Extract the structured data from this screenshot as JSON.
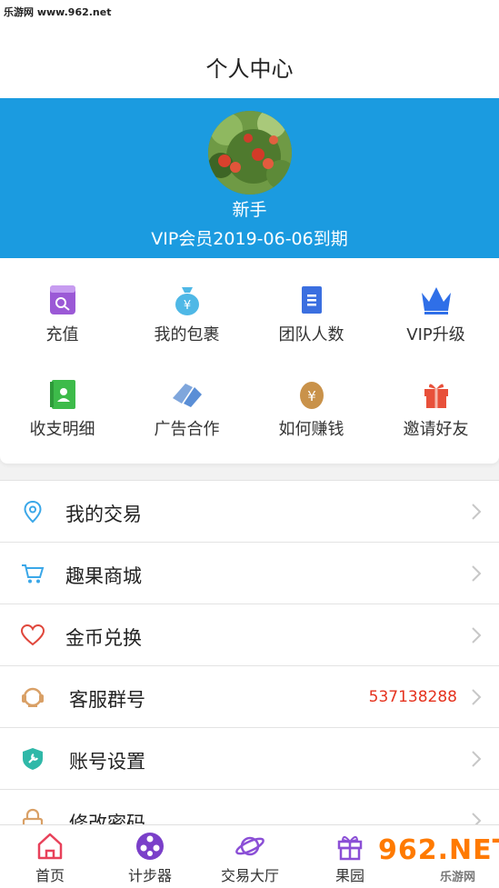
{
  "status_bar": {
    "watermark": "乐游网 www.962.net"
  },
  "header": {
    "title": "个人中心"
  },
  "profile": {
    "name": "新手",
    "vip_text": "VIP会员2019-06-06到期"
  },
  "grid": {
    "items": [
      {
        "label": "充值",
        "icon": "recharge-card-icon",
        "color": "#9b59d6"
      },
      {
        "label": "我的包裹",
        "icon": "money-bag-icon",
        "color": "#4fb8e6"
      },
      {
        "label": "团队人数",
        "icon": "document-icon",
        "color": "#3b6fe0"
      },
      {
        "label": "VIP升级",
        "icon": "crown-icon",
        "color": "#2f6fe8"
      },
      {
        "label": "收支明细",
        "icon": "contact-book-icon",
        "color": "#3dbb4a"
      },
      {
        "label": "广告合作",
        "icon": "handshake-icon",
        "color": "#5a8ed6"
      },
      {
        "label": "如何赚钱",
        "icon": "yen-coin-icon",
        "color": "#c9924a"
      },
      {
        "label": "邀请好友",
        "icon": "gift-icon",
        "color": "#e8503a"
      }
    ]
  },
  "menu": {
    "items": [
      {
        "label": "我的交易",
        "icon": "location-pin-icon",
        "value": ""
      },
      {
        "label": "趣果商城",
        "icon": "shopping-cart-icon",
        "value": ""
      },
      {
        "label": "金币兑换",
        "icon": "heart-icon",
        "value": ""
      },
      {
        "label": "客服群号",
        "icon": "headset-icon",
        "value": "537138288"
      },
      {
        "label": "账号设置",
        "icon": "wrench-shield-icon",
        "value": ""
      },
      {
        "label": "修改密码",
        "icon": "lock-icon",
        "value": ""
      }
    ]
  },
  "tabs": {
    "items": [
      {
        "label": "首页",
        "icon": "home-icon"
      },
      {
        "label": "计步器",
        "icon": "film-reel-icon"
      },
      {
        "label": "交易大厅",
        "icon": "planet-icon"
      },
      {
        "label": "果园",
        "icon": "gift-box-icon"
      }
    ]
  },
  "watermark": {
    "main": "962.NET",
    "sub": "乐游网"
  },
  "colors": {
    "profile_bg": "#1b9be0",
    "accent_red": "#e5331f"
  }
}
